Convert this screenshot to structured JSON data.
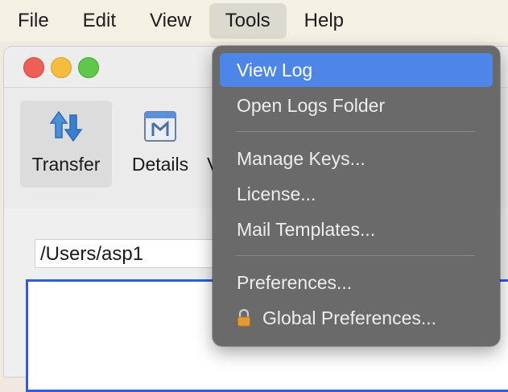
{
  "menubar": {
    "items": [
      "File",
      "Edit",
      "View",
      "Tools",
      "Help"
    ],
    "active": "Tools"
  },
  "window": {
    "toolbar": {
      "transfer_label": "Transfer",
      "details_label": "Details",
      "extra_label": "V"
    },
    "path_field": "/Users/asp1"
  },
  "tools_menu": {
    "view_log": "View Log",
    "open_logs_folder": "Open Logs Folder",
    "manage_keys": "Manage Keys...",
    "license": "License...",
    "mail_templates": "Mail Templates...",
    "preferences": "Preferences...",
    "global_preferences": "Global Preferences..."
  },
  "colors": {
    "menu_highlight": "#4d86e8",
    "menu_background": "#6a6a6a",
    "selection_border": "#2f5ce0"
  }
}
